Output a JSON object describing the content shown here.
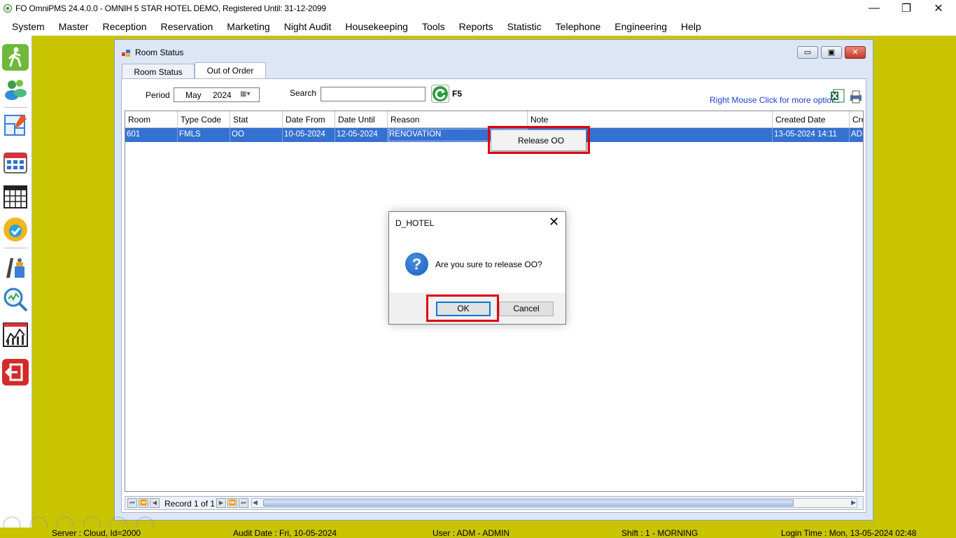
{
  "window": {
    "title": "FO OmniPMS 24.4.0.0 - OMNIH 5 STAR HOTEL DEMO, Registered Until: 31-12-2099",
    "minimize": "—",
    "restore": "❐",
    "close": "✕"
  },
  "menu": [
    "System",
    "Master",
    "Reception",
    "Reservation",
    "Marketing",
    "Night Audit",
    "Housekeeping",
    "Tools",
    "Reports",
    "Statistic",
    "Telephone",
    "Engineering",
    "Help"
  ],
  "child_window": {
    "title": "Room Status",
    "tabs": [
      "Room Status",
      "Out of Order"
    ],
    "active_tab": "Out of Order",
    "period_label": "Period",
    "period_month": "May",
    "period_year": "2024",
    "search_label": "Search",
    "search_value": "",
    "refresh_key": "F5",
    "right_click_hint": "Right Mouse Click for more options"
  },
  "grid": {
    "columns": [
      "Room",
      "Type Code",
      "Stat",
      "Date From",
      "Date Until",
      "Reason",
      "Note",
      "Created Date",
      "Cre"
    ],
    "rows": [
      [
        "601",
        "FMLS",
        "OO",
        "10-05-2024",
        "12-05-2024",
        "RENOVATION",
        "",
        "13-05-2024 14:11",
        "ADM"
      ]
    ],
    "record_label": "Record 1 of 1"
  },
  "context_menu": {
    "items": [
      "Release OO"
    ]
  },
  "dialog": {
    "title": "D_HOTEL",
    "message": "Are you sure to release OO?",
    "ok_label": "OK",
    "cancel_label": "Cancel",
    "icon": "question-icon"
  },
  "status_bar": {
    "server": "Server : Cloud, Id=2000",
    "audit_date": "Audit Date : Fri, 10-05-2024",
    "user": "User : ADM - ADMIN",
    "shift": "Shift : 1 - MORNING",
    "login_time": "Login Time : Mon, 13-05-2024 02:48"
  },
  "colors": {
    "desktop": "#c8c400",
    "selection": "#3571d0",
    "highlight_box": "#e0000f",
    "link": "#1a3fd1"
  }
}
